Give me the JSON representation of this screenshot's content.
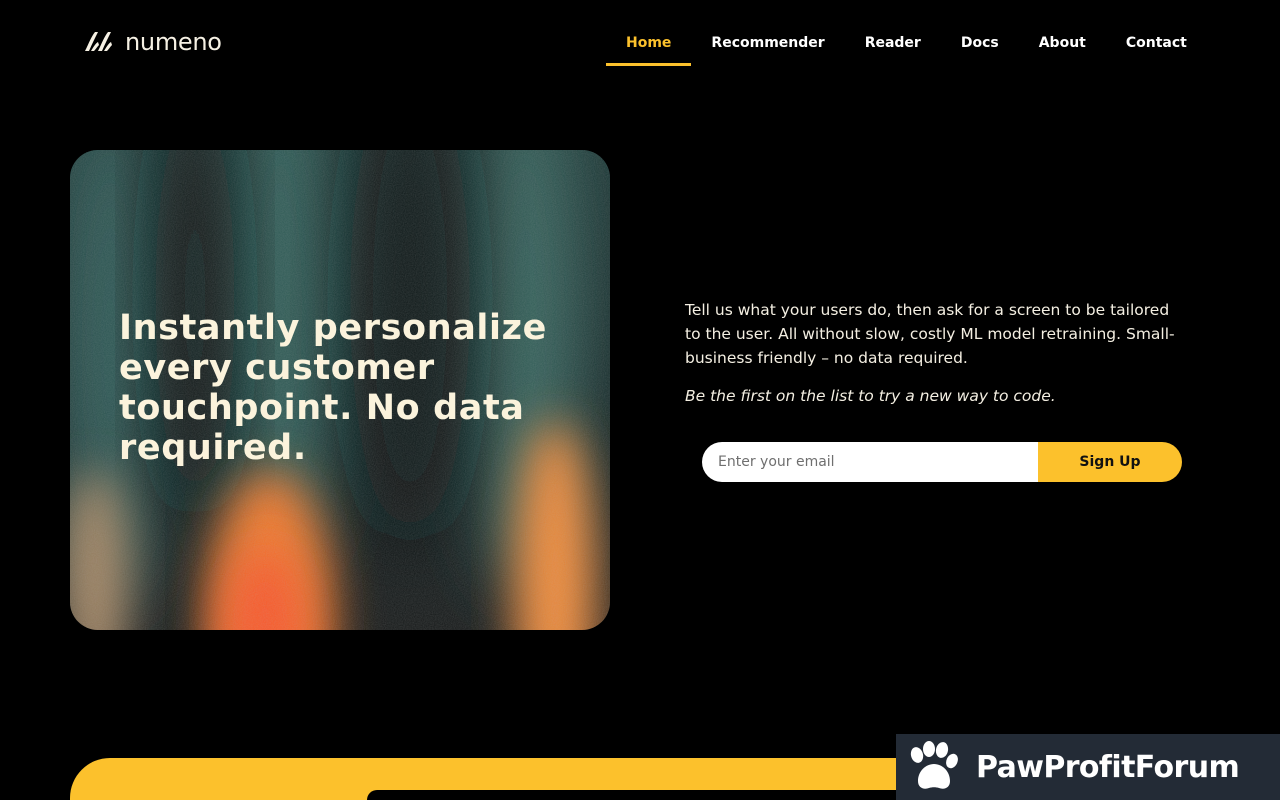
{
  "brand": {
    "name": "numeno",
    "logo_icon": "numeno-logo-icon",
    "accent_color": "#fcc12c"
  },
  "nav": {
    "items": [
      {
        "label": "Home",
        "active": true
      },
      {
        "label": "Recommender",
        "active": false
      },
      {
        "label": "Reader",
        "active": false
      },
      {
        "label": "Docs",
        "active": false
      },
      {
        "label": "About",
        "active": false
      },
      {
        "label": "Contact",
        "active": false
      }
    ]
  },
  "hero": {
    "title": "Instantly personalize every customer touchpoint. No data required."
  },
  "intro": {
    "text": "Tell us what your users do, then ask for a screen to be tailored to the user.  All without slow, costly ML model retraining.  Small-business friendly – no data required.",
    "tagline": "Be the first on the list to try a new way to code."
  },
  "signup": {
    "email_placeholder": "Enter your email",
    "email_value": "",
    "button_label": "Sign Up"
  },
  "watermark": {
    "icon": "paw-icon",
    "text": "PawProfitForum"
  }
}
